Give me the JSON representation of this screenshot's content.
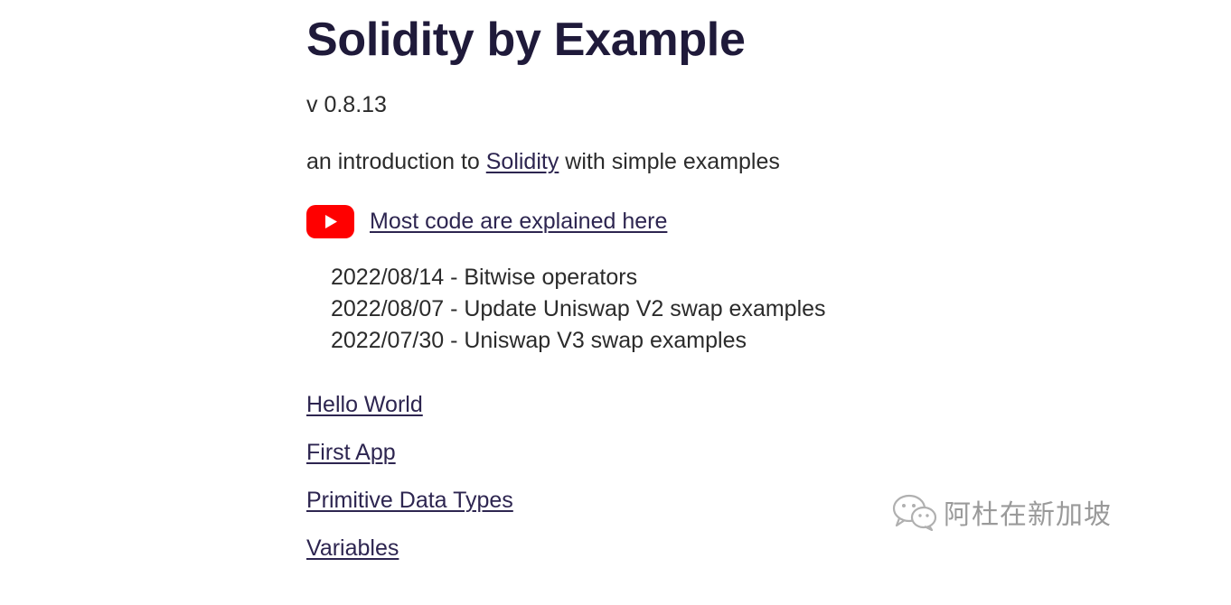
{
  "header": {
    "title": "Solidity by Example",
    "version": "v 0.8.13"
  },
  "intro": {
    "prefix": "an introduction to ",
    "link_label": "Solidity",
    "suffix": " with simple examples"
  },
  "video": {
    "icon": "youtube-icon",
    "link_label": "Most code are explained here",
    "brand_color": "#ff0000"
  },
  "updates": [
    {
      "text": "2022/08/14 - Bitwise operators"
    },
    {
      "text": "2022/08/07 - Update Uniswap V2 swap examples"
    },
    {
      "text": "2022/07/30 - Uniswap V3 swap examples"
    }
  ],
  "nav": [
    {
      "label": "Hello World"
    },
    {
      "label": "First App"
    },
    {
      "label": "Primitive Data Types"
    },
    {
      "label": "Variables"
    }
  ],
  "watermark": {
    "icon": "wechat-icon",
    "text": "阿杜在新加坡"
  }
}
